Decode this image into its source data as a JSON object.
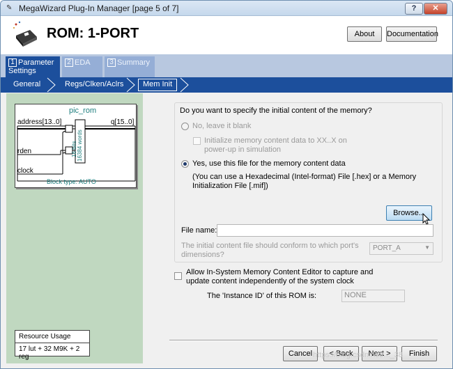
{
  "window": {
    "title": "MegaWizard Plug-In Manager [page 5 of 7]",
    "help_label": "?",
    "close_label": "✕"
  },
  "header": {
    "heading": "ROM: 1-PORT",
    "about_label": "About",
    "documentation_label": "Documentation"
  },
  "tabs": [
    {
      "num": "1",
      "label": "Parameter Settings",
      "active": true
    },
    {
      "num": "2",
      "label": "EDA",
      "active": false
    },
    {
      "num": "3",
      "label": "Summary",
      "active": false
    }
  ],
  "breadcrumbs": {
    "items": [
      "General",
      "Regs/Clken/Aclrs",
      "Mem Init"
    ],
    "active_index": 2
  },
  "symbol": {
    "name": "pic_rom",
    "port_address": "address[13..0]",
    "port_q": "q[15..0]",
    "port_rden": "rden",
    "port_clock": "clock",
    "block_bits": "16 bits",
    "block_words": "16384 words",
    "block_type": "Block type: AUTO"
  },
  "resource": {
    "heading": "Resource Usage",
    "value": "17 lut + 32 M9K + 2 reg"
  },
  "mem_init": {
    "question": "Do you want to specify the initial content of the memory?",
    "option_no": "No, leave it blank",
    "init_xx_line1": "Initialize memory content data to XX..X on",
    "init_xx_line2": "power-up in simulation",
    "option_yes": "Yes, use this file for the memory content data",
    "hint_line1": "(You can use a Hexadecimal (Intel-format) File [.hex] or a Memory",
    "hint_line2": "Initialization File [.mif])",
    "browse_label": "Browse...",
    "file_name_label": "File name:",
    "file_name_value": "",
    "conform_line1": "The initial content file should conform to which port's",
    "conform_line2": "dimensions?",
    "port_select": "PORT_A"
  },
  "in_system": {
    "line1": "Allow In-System Memory Content Editor to capture and",
    "line2": "update content independently of the system clock",
    "instance_label": "The 'Instance ID' of this ROM is:",
    "instance_value": "NONE"
  },
  "footer": {
    "cancel_label": "Cancel",
    "back_label": "< Back",
    "next_label": "Next >",
    "finish_label": "Finish"
  },
  "watermark": "https://blog.csdn.net/..._38"
}
